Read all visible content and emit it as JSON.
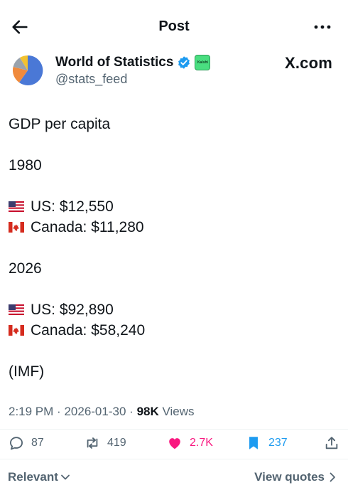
{
  "header": {
    "title": "Post"
  },
  "author": {
    "name": "World of Statistics",
    "handle": "@stats_feed",
    "affiliate_badge_text": "Kalshi"
  },
  "source_label": "X.com",
  "post": {
    "title_line": "GDP per capita",
    "year1": "1980",
    "year1_us": "US: $12,550",
    "year1_canada": "Canada: $11,280",
    "year2": "2026",
    "year2_us": "US: $92,890",
    "year2_canada": "Canada: $58,240",
    "source": "(IMF)"
  },
  "meta": {
    "time": "2:19 PM",
    "separator": "·",
    "date": "2026-01-30",
    "views_count": "98K",
    "views_label": "Views"
  },
  "actions": {
    "replies": "87",
    "reposts": "419",
    "likes": "2.7K",
    "bookmarks": "237"
  },
  "footer": {
    "sort_label": "Relevant",
    "view_quotes_label": "View quotes"
  },
  "colors": {
    "text": "#0f1419",
    "muted": "#536471",
    "like": "#f91880",
    "accent": "#1d9bf0"
  },
  "icons": [
    "back-arrow-icon",
    "more-icon",
    "verified-badge-icon",
    "reply-icon",
    "repost-icon",
    "heart-icon",
    "bookmark-icon",
    "share-icon",
    "us-flag-icon",
    "canada-flag-icon",
    "chevron-down-icon",
    "chevron-right-icon"
  ]
}
